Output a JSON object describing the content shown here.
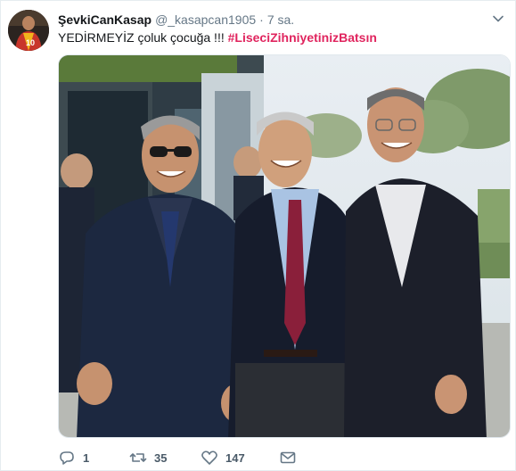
{
  "tweet": {
    "author": {
      "display_name": "ŞevkiCanKasap",
      "handle": "@_kasapcan1905",
      "avatar_icon": "user-avatar"
    },
    "separator": "·",
    "timestamp": "7 sa.",
    "text": "YEDİRMEYİZ çoluk çocuğa !!! ",
    "hashtag": "#LiseciZihniyetinizBatsın",
    "hashtag_color": "#e0245e",
    "media": {
      "type": "photo",
      "description_icon": "photo-three-men"
    },
    "actions": {
      "reply": {
        "icon": "reply-icon",
        "count": "1"
      },
      "retweet": {
        "icon": "retweet-icon",
        "count": "35"
      },
      "like": {
        "icon": "heart-icon",
        "count": "147"
      },
      "dm": {
        "icon": "envelope-icon"
      }
    }
  }
}
